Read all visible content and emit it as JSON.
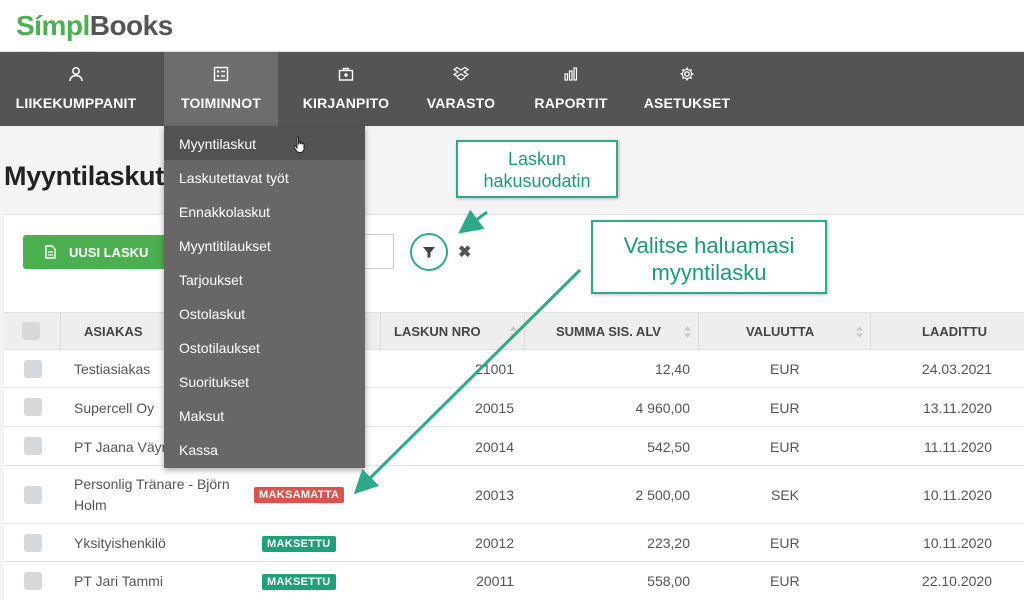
{
  "app": {
    "logo_part1": "Símpl",
    "logo_part2": "Books"
  },
  "nav": {
    "items": [
      {
        "label": "LIIKEKUMPPANIT",
        "icon": "user-icon"
      },
      {
        "label": "TOIMINNOT",
        "icon": "list-icon",
        "active": true
      },
      {
        "label": "KIRJANPITO",
        "icon": "briefcase-icon"
      },
      {
        "label": "VARASTO",
        "icon": "boxes-icon"
      },
      {
        "label": "RAPORTIT",
        "icon": "bar-chart-icon"
      },
      {
        "label": "ASETUKSET",
        "icon": "gear-icon"
      }
    ]
  },
  "dropdown": {
    "items": [
      "Myyntilaskut",
      "Laskutettavat työt",
      "Ennakkolaskut",
      "Myyntitilaukset",
      "Tarjoukset",
      "Ostolaskut",
      "Ostotilaukset",
      "Suoritukset",
      "Maksut",
      "Kassa"
    ],
    "hovered": "Myyntilaskut"
  },
  "page": {
    "title": "Myyntilaskut"
  },
  "toolbar": {
    "new_invoice_label": "UUSI LASKU",
    "clear_symbol": "✖"
  },
  "table": {
    "headers": {
      "customer": "ASIAKAS",
      "invoice_no": "LASKUN NRO",
      "sum": "SUMMA SIS. ALV",
      "currency": "VALUUTTA",
      "created": "LAADITTU"
    },
    "rows": [
      {
        "customer": "Testiasiakas",
        "status": "",
        "invoice_no": "21001",
        "sum": "12,40",
        "currency": "EUR",
        "created": "24.03.2021"
      },
      {
        "customer": "Supercell Oy",
        "status": "",
        "invoice_no": "20015",
        "sum": "4 960,00",
        "currency": "EUR",
        "created": "13.11.2020"
      },
      {
        "customer": "PT Jaana Väyry",
        "status": "",
        "invoice_no": "20014",
        "sum": "542,50",
        "currency": "EUR",
        "created": "11.11.2020"
      },
      {
        "customer_line1": "Personlig Tränare - Björn",
        "customer_line2": "Holm",
        "status": "MAKSAMATTA",
        "invoice_no": "20013",
        "sum": "2 500,00",
        "currency": "SEK",
        "created": "10.11.2020"
      },
      {
        "customer": "Yksityishenkilö",
        "status": "MAKSETTU",
        "invoice_no": "20012",
        "sum": "223,20",
        "currency": "EUR",
        "created": "10.11.2020"
      },
      {
        "customer": "PT Jari Tammi",
        "status": "MAKSETTU",
        "invoice_no": "20011",
        "sum": "558,00",
        "currency": "EUR",
        "created": "22.10.2020"
      }
    ]
  },
  "callouts": {
    "filter_line1": "Laskun",
    "filter_line2": "hakusuodatin",
    "select_line1": "Valitse haluamasi",
    "select_line2": "myyntilasku"
  },
  "colors": {
    "accent": "#2eaa8a",
    "nav_bg": "#545454",
    "green": "#4caf50",
    "unpaid": "#d9534f",
    "paid": "#1fa078"
  }
}
